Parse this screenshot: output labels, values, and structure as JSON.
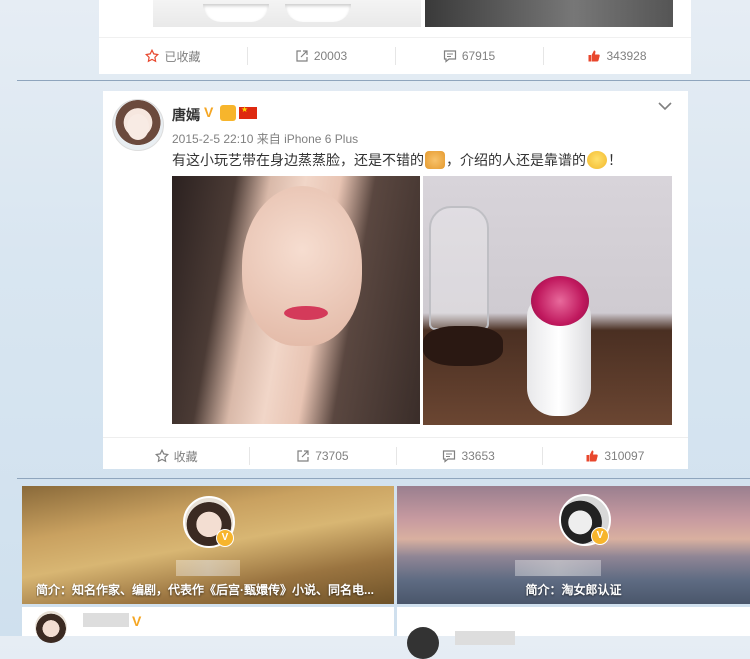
{
  "top_card": {
    "actions": [
      {
        "label": "已收藏",
        "icon": "star-icon"
      },
      {
        "label": "20003",
        "icon": "forward-icon"
      },
      {
        "label": "67915",
        "icon": "comment-icon"
      },
      {
        "label": "343928",
        "icon": "like-icon"
      }
    ]
  },
  "post": {
    "username": "唐嫣",
    "verified_badge": "V",
    "timestamp": "2015-2-5 22:10",
    "source": "来自 iPhone 6 Plus",
    "text_part1": "有这小玩艺带在身边蒸蒸脸，还是不错的",
    "text_part2": "，介绍的人还是靠谱的",
    "text_part3": "！",
    "actions": [
      {
        "label": "收藏",
        "icon": "star-icon"
      },
      {
        "label": "73705",
        "icon": "forward-icon"
      },
      {
        "label": "33653",
        "icon": "comment-icon"
      },
      {
        "label": "310097",
        "icon": "like-icon"
      }
    ]
  },
  "recommend_cards": [
    {
      "intro": "简介：知名作家、编剧，代表作《后宫·甄嬛传》小说、同名电...",
      "badge": "V"
    },
    {
      "intro": "简介：淘女郎认证",
      "badge": "V"
    }
  ],
  "colors": {
    "accent_orange": "#f5a623",
    "like_red": "#e8472d",
    "divider": "#8fa5bd"
  }
}
